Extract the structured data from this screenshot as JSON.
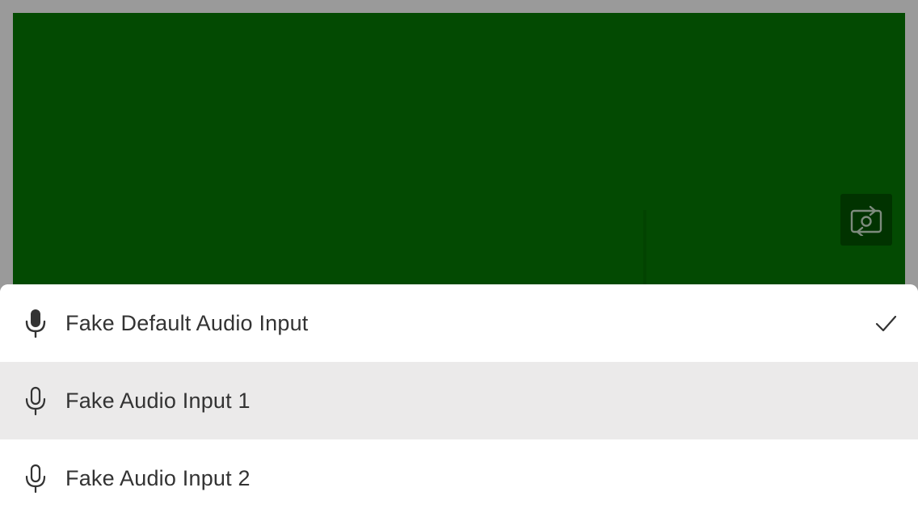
{
  "video": {
    "background_color": "#034a02",
    "switch_camera_icon": "switch-camera-icon"
  },
  "audio_device_menu": {
    "items": [
      {
        "label": "Fake Default Audio Input",
        "icon": "microphone-filled-icon",
        "selected": true,
        "hovered": false
      },
      {
        "label": "Fake Audio Input 1",
        "icon": "microphone-outline-icon",
        "selected": false,
        "hovered": true
      },
      {
        "label": "Fake Audio Input 2",
        "icon": "microphone-outline-icon",
        "selected": false,
        "hovered": false
      }
    ],
    "selected_icon": "checkmark-icon",
    "hover_color": "#ebeaea",
    "text_color": "#333333"
  }
}
